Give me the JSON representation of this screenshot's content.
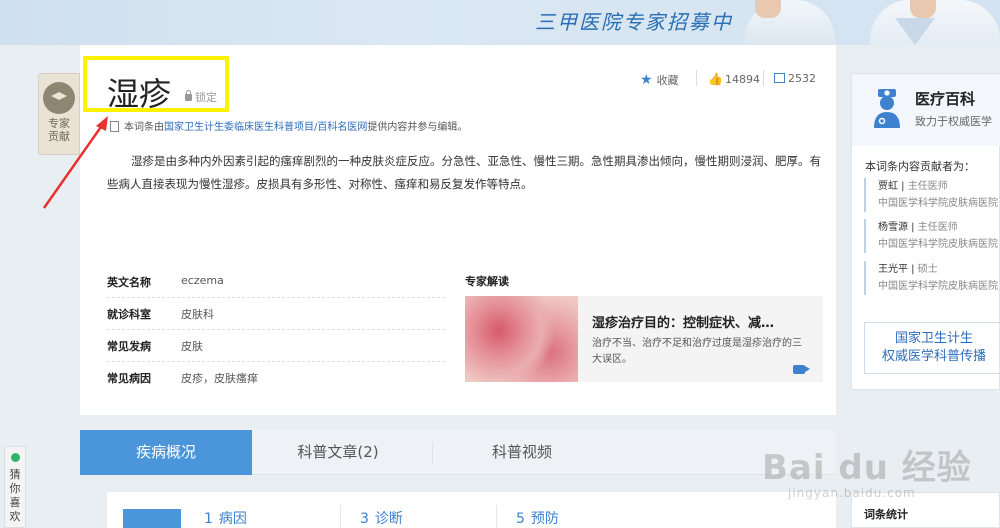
{
  "banner": {
    "text": "三甲医院专家招募中"
  },
  "expert_badge": {
    "line1": "专家",
    "line2": "贡献"
  },
  "entry": {
    "title": "湿疹",
    "lock_label": "锁定",
    "favorite_label": "收藏",
    "likes": "14894",
    "shares": "2532",
    "source_prefix": "本词条由",
    "source_link": "国家卫生计生委临床医生科普项目/百科名医网",
    "source_suffix": "提供内容并参与编辑。",
    "summary": "湿疹是由多种内外因素引起的瘙痒剧烈的一种皮肤炎症反应。分急性、亚急性、慢性三期。急性期具渗出倾向，慢性期则浸润、肥厚。有些病人直接表现为慢性湿疹。皮损具有多形性、对称性、瘙痒和易反复发作等特点。"
  },
  "info": [
    {
      "key": "英文名称",
      "value": "eczema"
    },
    {
      "key": "就诊科室",
      "value": "皮肤科"
    },
    {
      "key": "常见发病",
      "value": "皮肤"
    },
    {
      "key": "常见病因",
      "value": "皮疹，皮肤瘙痒"
    }
  ],
  "expert": {
    "section_title": "专家解读",
    "headline": "湿疹治疗目的：控制症状、减…",
    "desc": "治疗不当、治疗不足和治疗过度是湿疹治疗的三大误区。"
  },
  "sidebar": {
    "title": "医疗百科",
    "subtitle": "致力于权威医学",
    "contrib_title": "本词条内容贡献者为：",
    "contributors": [
      {
        "name": "贾虹",
        "role": "主任医师",
        "hospital": "中国医学科学院皮肤病医院"
      },
      {
        "name": "杨雪源",
        "role": "主任医师",
        "hospital": "中国医学科学院皮肤病医院"
      },
      {
        "name": "王光平",
        "role": "硕士",
        "hospital": "中国医学科学院皮肤病医院"
      }
    ],
    "button_line1": "国家卫生计生",
    "button_line2": "权威医学科普传播"
  },
  "tabs": [
    {
      "label": "疾病概况"
    },
    {
      "label": "科普文章(2)"
    },
    {
      "label": "科普视频"
    }
  ],
  "outline": [
    {
      "num": "1",
      "label": "病因"
    },
    {
      "num": "3",
      "label": "诊断"
    },
    {
      "num": "5",
      "label": "预防"
    }
  ],
  "stats_title": "词条统计",
  "guess": {
    "label": "猜你喜欢"
  },
  "watermark": {
    "main": "Bai du 经验",
    "sub": "jingyan.baidu.com"
  },
  "colors": {
    "accent": "#4b95db",
    "highlight_box": "#fff200",
    "annotation_arrow": "#e8322f"
  }
}
